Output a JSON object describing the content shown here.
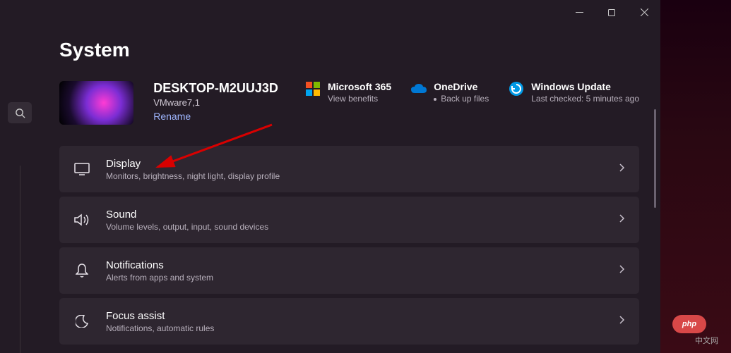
{
  "page_title": "System",
  "pc": {
    "name": "DESKTOP-M2UUJ3D",
    "model": "VMware7,1",
    "rename": "Rename"
  },
  "quick": {
    "ms365": {
      "title": "Microsoft 365",
      "sub": "View benefits"
    },
    "onedrive": {
      "title": "OneDrive",
      "sub": "Back up files"
    },
    "update": {
      "title": "Windows Update",
      "sub": "Last checked: 5 minutes ago"
    }
  },
  "items": [
    {
      "title": "Display",
      "sub": "Monitors, brightness, night light, display profile"
    },
    {
      "title": "Sound",
      "sub": "Volume levels, output, input, sound devices"
    },
    {
      "title": "Notifications",
      "sub": "Alerts from apps and system"
    },
    {
      "title": "Focus assist",
      "sub": "Notifications, automatic rules"
    }
  ],
  "badge": {
    "text": "php",
    "cn": "中文网"
  }
}
